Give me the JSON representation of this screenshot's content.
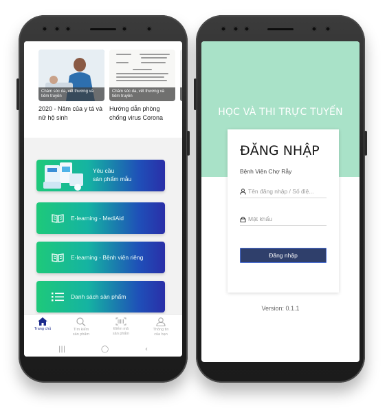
{
  "left_phone": {
    "news": [
      {
        "category": "Chăm sóc da, vết thương và tiêm truyền",
        "title": "2020 - Năm của y tá và nữ hộ sinh"
      },
      {
        "category": "Chăm sóc da, vết thương và tiêm truyền",
        "title": "Hướng dẫn phòng chống virus Corona"
      },
      {
        "category": "",
        "title": ""
      }
    ],
    "menu": {
      "request_samples": "Yêu cầu\nsản phẩm mẫu",
      "elearning_mediaid": "E-learning - MediAid",
      "elearning_hospital": "E-learning - Bệnh viện riêng",
      "product_list": "Danh sách sản phẩm"
    },
    "nav": {
      "home": "Trang chủ",
      "search": "Tìm kiếm\nsản phẩm",
      "scan": "Điểm mã\nsản phẩm",
      "account": "Thông tin\ncủa bạn"
    }
  },
  "right_phone": {
    "app_title": "HỌC VÀ THI TRỰC TUYẾN",
    "login": {
      "title": "ĐĂNG NHẬP",
      "hospital": "Bệnh Viện Chợ Rẫy",
      "username_placeholder": "Tên đăng nhập / Số điệ...",
      "password_placeholder": "Mật khẩu",
      "button": "Đăng nhập"
    },
    "version": "Version: 0.1.1"
  },
  "colors": {
    "hero_green": "#a9e2c8",
    "button_navy": "#2f3f6b",
    "nav_active": "#1c2a8c",
    "card_gradient_start": "#1ec97a",
    "card_gradient_end": "#2a2fa8"
  }
}
